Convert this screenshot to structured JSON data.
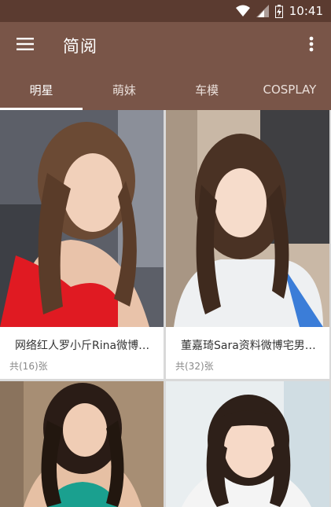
{
  "status_bar": {
    "time": "10:41"
  },
  "app_bar": {
    "title": "简阅",
    "menu_icon": "hamburger-menu-icon",
    "more_icon": "more-vert-icon"
  },
  "tabs": [
    {
      "label": "明星",
      "active": true
    },
    {
      "label": "萌妹",
      "active": false
    },
    {
      "label": "车模",
      "active": false
    },
    {
      "label": "COSPLAY",
      "active": false
    }
  ],
  "cards": [
    {
      "title": "网络红人罗小斤Rina微博…",
      "count": "共(16)张"
    },
    {
      "title": "董嘉琦Sara资料微博宅男…",
      "count": "共(32)张"
    }
  ],
  "colors": {
    "primary": "#795548",
    "status": "#5b3b30"
  }
}
